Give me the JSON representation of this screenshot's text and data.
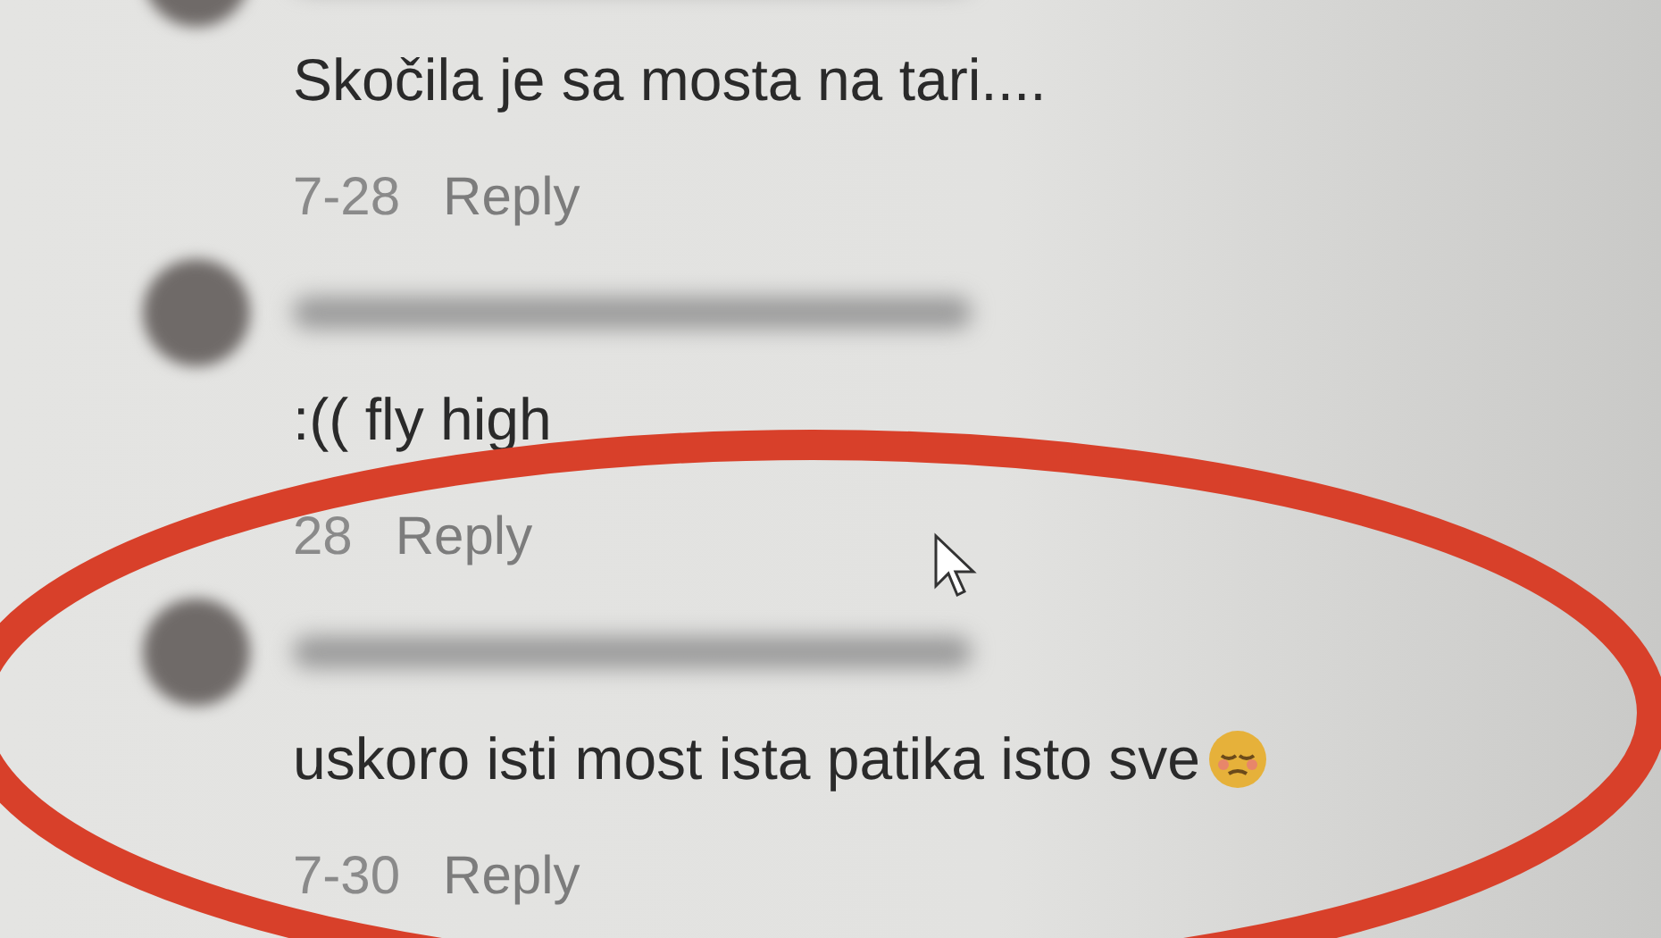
{
  "comments": [
    {
      "text": "Skočila je sa mosta na tari....",
      "date": "7-28",
      "reply": "Reply"
    },
    {
      "text": ":(( fly high",
      "date": "28",
      "reply": "Reply"
    },
    {
      "text": "uskoro isti most ista patika isto sve",
      "date": "7-30",
      "reply": "Reply"
    }
  ]
}
